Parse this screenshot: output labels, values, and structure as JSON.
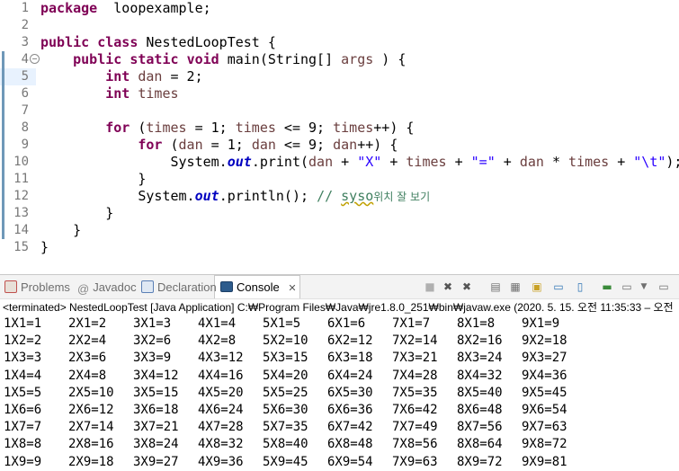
{
  "editor": {
    "lines": [
      {
        "num": "1",
        "segments": [
          [
            "kw",
            "package"
          ],
          [
            "",
            "  loopexample;"
          ]
        ]
      },
      {
        "num": "2",
        "segments": []
      },
      {
        "num": "3",
        "segments": [
          [
            "kw",
            "public"
          ],
          [
            "",
            " "
          ],
          [
            "kw",
            "class"
          ],
          [
            "",
            " NestedLoopTest {"
          ]
        ]
      },
      {
        "num": "4",
        "segments": [
          [
            "",
            "    "
          ],
          [
            "kw",
            "public"
          ],
          [
            "",
            " "
          ],
          [
            "kw",
            "static"
          ],
          [
            "",
            " "
          ],
          [
            "kw",
            "void"
          ],
          [
            "",
            " main(String[] "
          ],
          [
            "var",
            "args"
          ],
          [
            "",
            " ) {"
          ]
        ]
      },
      {
        "num": "5",
        "segments": [
          [
            "",
            "        "
          ],
          [
            "kw",
            "int"
          ],
          [
            "",
            " "
          ],
          [
            "var",
            "dan"
          ],
          [
            "",
            " = 2;"
          ]
        ]
      },
      {
        "num": "6",
        "segments": [
          [
            "",
            "        "
          ],
          [
            "kw",
            "int"
          ],
          [
            "",
            " "
          ],
          [
            "var",
            "times"
          ],
          [
            ";",
            " "
          ]
        ]
      },
      {
        "num": "7",
        "segments": []
      },
      {
        "num": "8",
        "segments": [
          [
            "",
            "        "
          ],
          [
            "kw",
            "for"
          ],
          [
            "",
            " ("
          ],
          [
            "var",
            "times"
          ],
          [
            "",
            " = 1; "
          ],
          [
            "var",
            "times"
          ],
          [
            "",
            " <= 9; "
          ],
          [
            "var",
            "times"
          ],
          [
            "",
            "++) {"
          ]
        ]
      },
      {
        "num": "9",
        "segments": [
          [
            "",
            "            "
          ],
          [
            "kw",
            "for"
          ],
          [
            "",
            " ("
          ],
          [
            "var",
            "dan"
          ],
          [
            "",
            " = 1; "
          ],
          [
            "var",
            "dan"
          ],
          [
            "",
            " <= 9; "
          ],
          [
            "var",
            "dan"
          ],
          [
            "",
            "++) {"
          ]
        ]
      },
      {
        "num": "10",
        "segments": [
          [
            "",
            "                System."
          ],
          [
            "fld",
            "out"
          ],
          [
            "",
            ".print("
          ],
          [
            "var",
            "dan"
          ],
          [
            "",
            " + "
          ],
          [
            "str",
            "\"X\""
          ],
          [
            "",
            " + "
          ],
          [
            "var",
            "times"
          ],
          [
            "",
            " + "
          ],
          [
            "str",
            "\"=\""
          ],
          [
            "",
            " + "
          ],
          [
            "var",
            "dan"
          ],
          [
            "",
            " * "
          ],
          [
            "var",
            "times"
          ],
          [
            "",
            " + "
          ],
          [
            "str",
            "\"\\t\""
          ],
          [
            "",
            ");"
          ]
        ]
      },
      {
        "num": "11",
        "segments": [
          [
            "",
            "            }"
          ]
        ]
      },
      {
        "num": "12",
        "segments": [
          [
            "",
            "            System."
          ],
          [
            "fld",
            "out"
          ],
          [
            "",
            ".println(); "
          ],
          [
            "cm",
            "// "
          ],
          [
            "cmu",
            "syso"
          ],
          [
            "cmk",
            "위치 잘 보기"
          ]
        ]
      },
      {
        "num": "13",
        "segments": [
          [
            "",
            "        }"
          ]
        ]
      },
      {
        "num": "14",
        "segments": [
          [
            "",
            "    }"
          ]
        ]
      },
      {
        "num": "15",
        "segments": [
          [
            "",
            "}"
          ]
        ]
      }
    ],
    "fold_marker": "⊖"
  },
  "view": {
    "tabs": [
      {
        "label": "Problems",
        "icon": "problems-icon",
        "color": "#c0504d"
      },
      {
        "label": "Javadoc",
        "icon": "at-icon",
        "color": "#7a7a7a"
      },
      {
        "label": "Declaration",
        "icon": "declaration-icon",
        "color": "#5a7fb5"
      },
      {
        "label": "Console",
        "icon": "console-icon",
        "color": "#3c6ea8",
        "active": true
      }
    ],
    "console_close": "✕",
    "terminated_line": "<terminated> NestedLoopTest [Java Application] C:₩Program Files₩Java₩jre1.8.0_251₩bin₩javaw.exe  (2020. 5. 15. 오전 11:35:33 – 오전",
    "toolbar_icons": [
      "terminate-icon",
      "remove-launch-icon",
      "remove-all-icon",
      "scroll-lock-icon",
      "pin-icon",
      "word-wrap-icon",
      "show-console-icon",
      "open-console-icon",
      "display-selected-icon",
      "view-menu-icon",
      "minimize-icon",
      "new-console-icon"
    ]
  },
  "output": [
    [
      "1X1=1",
      "2X1=2",
      "3X1=3",
      "4X1=4",
      "5X1=5",
      "6X1=6",
      "7X1=7",
      "8X1=8",
      "9X1=9"
    ],
    [
      "1X2=2",
      "2X2=4",
      "3X2=6",
      "4X2=8",
      "5X2=10",
      "6X2=12",
      "7X2=14",
      "8X2=16",
      "9X2=18"
    ],
    [
      "1X3=3",
      "2X3=6",
      "3X3=9",
      "4X3=12",
      "5X3=15",
      "6X3=18",
      "7X3=21",
      "8X3=24",
      "9X3=27"
    ],
    [
      "1X4=4",
      "2X4=8",
      "3X4=12",
      "4X4=16",
      "5X4=20",
      "6X4=24",
      "7X4=28",
      "8X4=32",
      "9X4=36"
    ],
    [
      "1X5=5",
      "2X5=10",
      "3X5=15",
      "4X5=20",
      "5X5=25",
      "6X5=30",
      "7X5=35",
      "8X5=40",
      "9X5=45"
    ],
    [
      "1X6=6",
      "2X6=12",
      "3X6=18",
      "4X6=24",
      "5X6=30",
      "6X6=36",
      "7X6=42",
      "8X6=48",
      "9X6=54"
    ],
    [
      "1X7=7",
      "2X7=14",
      "3X7=21",
      "4X7=28",
      "5X7=35",
      "6X7=42",
      "7X7=49",
      "8X7=56",
      "9X7=63"
    ],
    [
      "1X8=8",
      "2X8=16",
      "3X8=24",
      "4X8=32",
      "5X8=40",
      "6X8=48",
      "7X8=56",
      "8X8=64",
      "9X8=72"
    ],
    [
      "1X9=9",
      "2X9=18",
      "3X9=27",
      "4X9=36",
      "5X9=45",
      "6X9=54",
      "7X9=63",
      "8X9=72",
      "9X9=81"
    ]
  ]
}
